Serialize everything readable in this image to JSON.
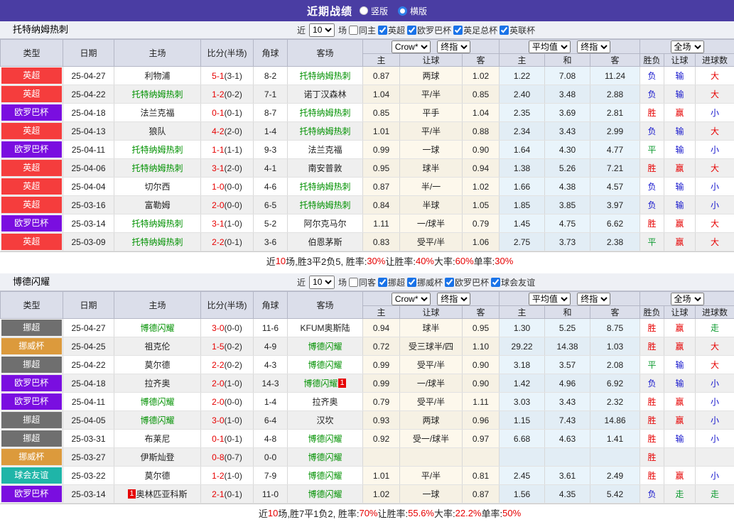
{
  "topbar": {
    "title": "近期战绩",
    "radios": [
      {
        "label": "竖版",
        "selected": false
      },
      {
        "label": "横版",
        "selected": true
      }
    ]
  },
  "header": {
    "cols": [
      "类型",
      "日期",
      "主场",
      "比分(半场)",
      "角球",
      "客场"
    ],
    "g1a": "Crow*",
    "g1b": "终指",
    "g2a": "平均值",
    "g2b": "终指",
    "g3": "全场",
    "sub": [
      "主",
      "让球",
      "客",
      "主",
      "和",
      "客",
      "胜负",
      "让球",
      "进球数"
    ]
  },
  "colors": {
    "topbar": "#4a3da3",
    "checkbox_accent": "#1a73e8",
    "score_red": "#e60000",
    "team_green": "#009100",
    "types": {
      "英超": "#f53d3d",
      "欧罗巴杯": "#7a0ee0",
      "挪超": "#6f6f6f",
      "挪威杯": "#dc9a3c",
      "球会友谊": "#1fb5a8"
    },
    "results": {
      "r": "#e60000",
      "b": "#1414cc",
      "g": "#0f9b31"
    }
  },
  "sections": [
    {
      "team": "托特纳姆热刺",
      "filter": {
        "near": "近",
        "count": "10",
        "games": "场",
        "same_label": "同主",
        "same_checked": false,
        "leagues": [
          {
            "label": "英超",
            "checked": true
          },
          {
            "label": "欧罗巴杯",
            "checked": true
          },
          {
            "label": "英足总杯",
            "checked": true
          },
          {
            "label": "英联杯",
            "checked": true
          }
        ]
      },
      "rows": [
        {
          "type": "英超",
          "date": "25-04-27",
          "home": "利物浦",
          "hf": false,
          "hb": "",
          "score": "5-1",
          "half": "(3-1)",
          "corner": "8-2",
          "away": "托特纳姆热刺",
          "af": true,
          "ab": "",
          "odds": [
            "0.87",
            "两球",
            "1.02",
            "1.22",
            "7.08",
            "11.24"
          ],
          "res": [
            [
              "负",
              "b"
            ],
            [
              "输",
              "b"
            ],
            [
              "大",
              "r"
            ]
          ]
        },
        {
          "type": "英超",
          "date": "25-04-22",
          "home": "托特纳姆热刺",
          "hf": true,
          "hb": "",
          "score": "1-2",
          "half": "(0-2)",
          "corner": "7-1",
          "away": "诺丁汉森林",
          "af": false,
          "ab": "",
          "odds": [
            "1.04",
            "平/半",
            "0.85",
            "2.40",
            "3.48",
            "2.88"
          ],
          "res": [
            [
              "负",
              "b"
            ],
            [
              "输",
              "b"
            ],
            [
              "大",
              "r"
            ]
          ]
        },
        {
          "type": "欧罗巴杯",
          "date": "25-04-18",
          "home": "法兰克福",
          "hf": false,
          "hb": "",
          "score": "0-1",
          "half": "(0-1)",
          "corner": "8-7",
          "away": "托特纳姆热刺",
          "af": true,
          "ab": "",
          "odds": [
            "0.85",
            "平手",
            "1.04",
            "2.35",
            "3.69",
            "2.81"
          ],
          "res": [
            [
              "胜",
              "r"
            ],
            [
              "赢",
              "r"
            ],
            [
              "小",
              "b"
            ]
          ]
        },
        {
          "type": "英超",
          "date": "25-04-13",
          "home": "狼队",
          "hf": false,
          "hb": "",
          "score": "4-2",
          "half": "(2-0)",
          "corner": "1-4",
          "away": "托特纳姆热刺",
          "af": true,
          "ab": "",
          "odds": [
            "1.01",
            "平/半",
            "0.88",
            "2.34",
            "3.43",
            "2.99"
          ],
          "res": [
            [
              "负",
              "b"
            ],
            [
              "输",
              "b"
            ],
            [
              "大",
              "r"
            ]
          ]
        },
        {
          "type": "欧罗巴杯",
          "date": "25-04-11",
          "home": "托特纳姆热刺",
          "hf": true,
          "hb": "",
          "score": "1-1",
          "half": "(1-1)",
          "corner": "9-3",
          "away": "法兰克福",
          "af": false,
          "ab": "",
          "odds": [
            "0.99",
            "一球",
            "0.90",
            "1.64",
            "4.30",
            "4.77"
          ],
          "res": [
            [
              "平",
              "g"
            ],
            [
              "输",
              "b"
            ],
            [
              "小",
              "b"
            ]
          ]
        },
        {
          "type": "英超",
          "date": "25-04-06",
          "home": "托特纳姆热刺",
          "hf": true,
          "hb": "",
          "score": "3-1",
          "half": "(2-0)",
          "corner": "4-1",
          "away": "南安普敦",
          "af": false,
          "ab": "",
          "odds": [
            "0.95",
            "球半",
            "0.94",
            "1.38",
            "5.26",
            "7.21"
          ],
          "res": [
            [
              "胜",
              "r"
            ],
            [
              "赢",
              "r"
            ],
            [
              "大",
              "r"
            ]
          ]
        },
        {
          "type": "英超",
          "date": "25-04-04",
          "home": "切尔西",
          "hf": false,
          "hb": "",
          "score": "1-0",
          "half": "(0-0)",
          "corner": "4-6",
          "away": "托特纳姆热刺",
          "af": true,
          "ab": "",
          "odds": [
            "0.87",
            "半/一",
            "1.02",
            "1.66",
            "4.38",
            "4.57"
          ],
          "res": [
            [
              "负",
              "b"
            ],
            [
              "输",
              "b"
            ],
            [
              "小",
              "b"
            ]
          ]
        },
        {
          "type": "英超",
          "date": "25-03-16",
          "home": "富勒姆",
          "hf": false,
          "hb": "",
          "score": "2-0",
          "half": "(0-0)",
          "corner": "6-5",
          "away": "托特纳姆热刺",
          "af": true,
          "ab": "",
          "odds": [
            "0.84",
            "半球",
            "1.05",
            "1.85",
            "3.85",
            "3.97"
          ],
          "res": [
            [
              "负",
              "b"
            ],
            [
              "输",
              "b"
            ],
            [
              "小",
              "b"
            ]
          ]
        },
        {
          "type": "欧罗巴杯",
          "date": "25-03-14",
          "home": "托特纳姆热刺",
          "hf": true,
          "hb": "",
          "score": "3-1",
          "half": "(1-0)",
          "corner": "5-2",
          "away": "阿尔克马尔",
          "af": false,
          "ab": "",
          "odds": [
            "1.11",
            "一/球半",
            "0.79",
            "1.45",
            "4.75",
            "6.62"
          ],
          "res": [
            [
              "胜",
              "r"
            ],
            [
              "赢",
              "r"
            ],
            [
              "大",
              "r"
            ]
          ]
        },
        {
          "type": "英超",
          "date": "25-03-09",
          "home": "托特纳姆热刺",
          "hf": true,
          "hb": "",
          "score": "2-2",
          "half": "(0-1)",
          "corner": "3-6",
          "away": "伯恩茅斯",
          "af": false,
          "ab": "",
          "odds": [
            "0.83",
            "受平/半",
            "1.06",
            "2.75",
            "3.73",
            "2.38"
          ],
          "res": [
            [
              "平",
              "g"
            ],
            [
              "赢",
              "r"
            ],
            [
              "大",
              "r"
            ]
          ]
        }
      ],
      "summary": [
        [
          "近",
          0
        ],
        [
          "10",
          1
        ],
        [
          "场,胜3平2负5, 胜率:",
          0
        ],
        [
          "30%",
          1
        ],
        [
          " 让胜率:",
          0
        ],
        [
          "40%",
          1
        ],
        [
          " 大率:",
          0
        ],
        [
          "60%",
          1
        ],
        [
          " 单率:",
          0
        ],
        [
          "30%",
          1
        ]
      ]
    },
    {
      "team": "博德闪耀",
      "filter": {
        "near": "近",
        "count": "10",
        "games": "场",
        "same_label": "同客",
        "same_checked": false,
        "leagues": [
          {
            "label": "挪超",
            "checked": true
          },
          {
            "label": "挪威杯",
            "checked": true
          },
          {
            "label": "欧罗巴杯",
            "checked": true
          },
          {
            "label": "球会友谊",
            "checked": true
          }
        ]
      },
      "rows": [
        {
          "type": "挪超",
          "date": "25-04-27",
          "home": "博德闪耀",
          "hf": true,
          "hb": "",
          "score": "3-0",
          "half": "(0-0)",
          "corner": "11-6",
          "away": "KFUM奥斯陆",
          "af": false,
          "ab": "",
          "odds": [
            "0.94",
            "球半",
            "0.95",
            "1.30",
            "5.25",
            "8.75"
          ],
          "res": [
            [
              "胜",
              "r"
            ],
            [
              "赢",
              "r"
            ],
            [
              "走",
              "g"
            ]
          ]
        },
        {
          "type": "挪威杯",
          "date": "25-04-25",
          "home": "祖克伦",
          "hf": false,
          "hb": "",
          "score": "1-5",
          "half": "(0-2)",
          "corner": "4-9",
          "away": "博德闪耀",
          "af": true,
          "ab": "",
          "odds": [
            "0.72",
            "受三球半/四",
            "1.10",
            "29.22",
            "14.38",
            "1.03"
          ],
          "res": [
            [
              "胜",
              "r"
            ],
            [
              "赢",
              "r"
            ],
            [
              "大",
              "r"
            ]
          ]
        },
        {
          "type": "挪超",
          "date": "25-04-22",
          "home": "莫尔德",
          "hf": false,
          "hb": "",
          "score": "2-2",
          "half": "(0-2)",
          "corner": "4-3",
          "away": "博德闪耀",
          "af": true,
          "ab": "",
          "odds": [
            "0.99",
            "受平/半",
            "0.90",
            "3.18",
            "3.57",
            "2.08"
          ],
          "res": [
            [
              "平",
              "g"
            ],
            [
              "输",
              "b"
            ],
            [
              "大",
              "r"
            ]
          ]
        },
        {
          "type": "欧罗巴杯",
          "date": "25-04-18",
          "home": "拉齐奥",
          "hf": false,
          "hb": "",
          "score": "2-0",
          "half": "(1-0)",
          "corner": "14-3",
          "away": "博德闪耀",
          "af": true,
          "ab": "1",
          "odds": [
            "0.99",
            "一/球半",
            "0.90",
            "1.42",
            "4.96",
            "6.92"
          ],
          "res": [
            [
              "负",
              "b"
            ],
            [
              "输",
              "b"
            ],
            [
              "小",
              "b"
            ]
          ]
        },
        {
          "type": "欧罗巴杯",
          "date": "25-04-11",
          "home": "博德闪耀",
          "hf": true,
          "hb": "",
          "score": "2-0",
          "half": "(0-0)",
          "corner": "1-4",
          "away": "拉齐奥",
          "af": false,
          "ab": "",
          "odds": [
            "0.79",
            "受平/半",
            "1.11",
            "3.03",
            "3.43",
            "2.32"
          ],
          "res": [
            [
              "胜",
              "r"
            ],
            [
              "赢",
              "r"
            ],
            [
              "小",
              "b"
            ]
          ]
        },
        {
          "type": "挪超",
          "date": "25-04-05",
          "home": "博德闪耀",
          "hf": true,
          "hb": "",
          "score": "3-0",
          "half": "(1-0)",
          "corner": "6-4",
          "away": "汉坎",
          "af": false,
          "ab": "",
          "odds": [
            "0.93",
            "两球",
            "0.96",
            "1.15",
            "7.43",
            "14.86"
          ],
          "res": [
            [
              "胜",
              "r"
            ],
            [
              "赢",
              "r"
            ],
            [
              "小",
              "b"
            ]
          ]
        },
        {
          "type": "挪超",
          "date": "25-03-31",
          "home": "布莱尼",
          "hf": false,
          "hb": "",
          "score": "0-1",
          "half": "(0-1)",
          "corner": "4-8",
          "away": "博德闪耀",
          "af": true,
          "ab": "",
          "odds": [
            "0.92",
            "受一/球半",
            "0.97",
            "6.68",
            "4.63",
            "1.41"
          ],
          "res": [
            [
              "胜",
              "r"
            ],
            [
              "输",
              "b"
            ],
            [
              "小",
              "b"
            ]
          ]
        },
        {
          "type": "挪威杯",
          "date": "25-03-27",
          "home": "伊斯灿登",
          "hf": false,
          "hb": "",
          "score": "0-8",
          "half": "(0-7)",
          "corner": "0-0",
          "away": "博德闪耀",
          "af": true,
          "ab": "",
          "odds": [
            "",
            "",
            "",
            "",
            "",
            ""
          ],
          "res": [
            [
              "胜",
              "r"
            ],
            [
              "",
              ""
            ],
            [
              "",
              ""
            ]
          ]
        },
        {
          "type": "球会友谊",
          "date": "25-03-22",
          "home": "莫尔德",
          "hf": false,
          "hb": "",
          "score": "1-2",
          "half": "(1-0)",
          "corner": "7-9",
          "away": "博德闪耀",
          "af": true,
          "ab": "",
          "odds": [
            "1.01",
            "平/半",
            "0.81",
            "2.45",
            "3.61",
            "2.49"
          ],
          "res": [
            [
              "胜",
              "r"
            ],
            [
              "赢",
              "r"
            ],
            [
              "小",
              "b"
            ]
          ]
        },
        {
          "type": "欧罗巴杯",
          "date": "25-03-14",
          "home": "奥林匹亚科斯",
          "hf": false,
          "hb": "1",
          "score": "2-1",
          "half": "(0-1)",
          "corner": "11-0",
          "away": "博德闪耀",
          "af": true,
          "ab": "",
          "odds": [
            "1.02",
            "一球",
            "0.87",
            "1.56",
            "4.35",
            "5.42"
          ],
          "res": [
            [
              "负",
              "b"
            ],
            [
              "走",
              "g"
            ],
            [
              "走",
              "g"
            ]
          ]
        }
      ],
      "summary": [
        [
          "近",
          0
        ],
        [
          "10",
          1
        ],
        [
          "场,胜7平1负2, 胜率:",
          0
        ],
        [
          "70%",
          1
        ],
        [
          " 让胜率:",
          0
        ],
        [
          "55.6%",
          1
        ],
        [
          " 大率:",
          0
        ],
        [
          "22.2%",
          1
        ],
        [
          " 单率:",
          0
        ],
        [
          "50%",
          1
        ]
      ]
    }
  ]
}
